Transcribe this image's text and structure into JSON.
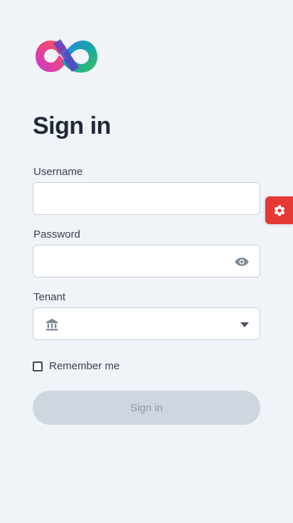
{
  "page": {
    "title": "Sign in"
  },
  "form": {
    "username": {
      "label": "Username",
      "value": "",
      "placeholder": ""
    },
    "password": {
      "label": "Password",
      "value": "",
      "placeholder": ""
    },
    "tenant": {
      "label": "Tenant",
      "selected": ""
    },
    "remember_me": {
      "label": "Remember me",
      "checked": false
    },
    "submit_label": "Sign in"
  },
  "icons": {
    "logo": "infinity-logo",
    "password_toggle": "eye-icon",
    "tenant_prefix": "bank-icon",
    "tenant_dropdown": "caret-down-icon",
    "settings": "gear-icon"
  },
  "colors": {
    "background": "#f0f4f9",
    "accent_settings": "#e53935",
    "button_disabled_bg": "#ced6e0",
    "button_disabled_text": "#8d97a5",
    "logo_gradient_start": "#ec3c7f",
    "logo_gradient_mid": "#7b3fd0",
    "logo_gradient_end": "#1fb46a"
  }
}
